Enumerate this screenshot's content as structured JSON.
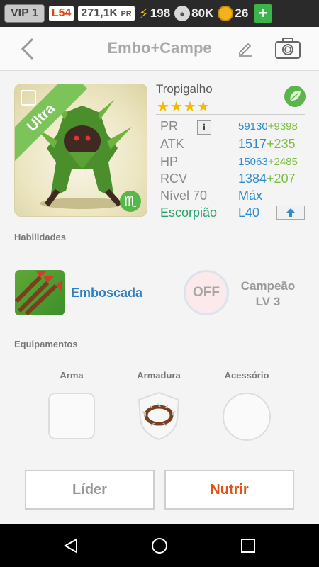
{
  "status_bar": {
    "vip": "VIP 1",
    "level": "L54",
    "power": "271,1K",
    "power_unit": "PR",
    "energy": "198",
    "food": "80K",
    "coins": "26",
    "plus": "+"
  },
  "header": {
    "title": "Embo+Campe"
  },
  "monster": {
    "rarity": "Ultra",
    "name": "Tropigalho",
    "stars": "★★★★",
    "element": "leaf",
    "zodiac_symbol": "♏"
  },
  "stats": {
    "pr": {
      "label": "PR",
      "value": "59130",
      "bonus": "+9398"
    },
    "atk": {
      "label": "ATK",
      "value": "1517",
      "bonus": "+235"
    },
    "hp": {
      "label": "HP",
      "value": "15063",
      "bonus": "+2485"
    },
    "rcv": {
      "label": "RCV",
      "value": "1384",
      "bonus": "+207"
    },
    "level": {
      "label": "Nível 70",
      "value": "Máx"
    },
    "zodiac": {
      "label": "Escorpião",
      "value": "L40"
    }
  },
  "skills": {
    "section_title": "Habilidades",
    "skill_name": "Emboscada",
    "off_label": "OFF",
    "champion_title": "Campeão",
    "champion_level": "LV 3"
  },
  "equipment": {
    "section_title": "Equipamentos",
    "weapon": "Arma",
    "armor": "Armadura",
    "accessory": "Acessório"
  },
  "actions": {
    "leader": "Líder",
    "feed": "Nutrir"
  },
  "colors": {
    "accent_blue": "#2d8bd1",
    "bonus_green": "#7bbe3f",
    "zodiac_green": "#27a36b",
    "feed_orange": "#e2511a",
    "level_red": "#e2440f"
  }
}
